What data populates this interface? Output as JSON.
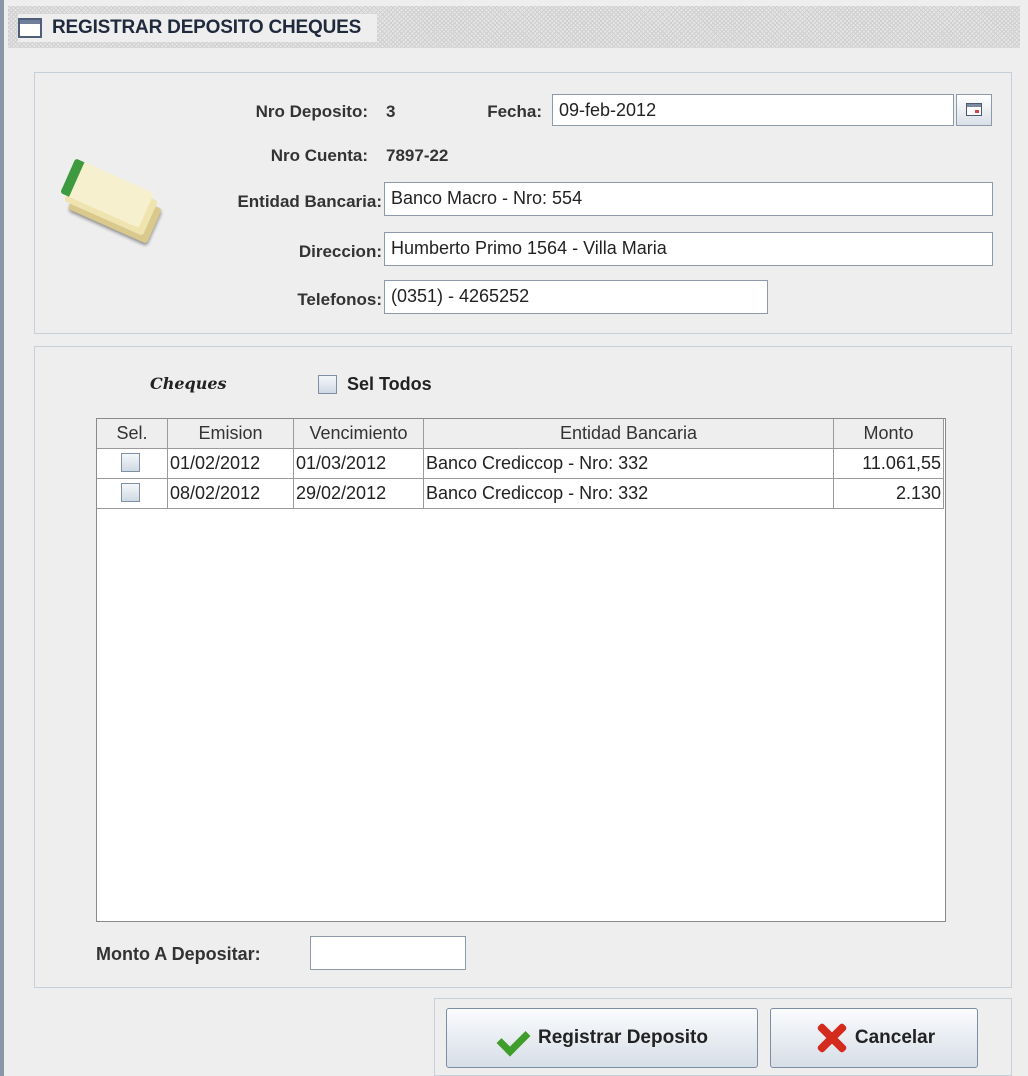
{
  "window": {
    "title": "REGISTRAR DEPOSITO CHEQUES",
    "icon": "window-icon"
  },
  "deposit": {
    "nro_deposito_label": "Nro Deposito:",
    "nro_deposito_value": "3",
    "fecha_label": "Fecha:",
    "fecha_value": "09-feb-2012",
    "nro_cuenta_label": "Nro Cuenta:",
    "nro_cuenta_value": "7897-22",
    "entidad_label": "Entidad Bancaria:",
    "entidad_value": "Banco Macro - Nro: 554",
    "direccion_label": "Direccion:",
    "direccion_value": "Humberto Primo 1564 - Villa Maria",
    "telefonos_label": "Telefonos:",
    "telefonos_value": "(0351) - 4265252",
    "calendar_icon": "calendar-icon",
    "cheques_icon": "cheques-icon"
  },
  "cheques": {
    "title": "Cheques",
    "select_all_label": "Sel Todos",
    "select_all_checked": false,
    "columns": [
      "Sel.",
      "Emision",
      "Vencimiento",
      "Entidad Bancaria",
      "Monto"
    ],
    "rows": [
      {
        "selected": false,
        "emision": "01/02/2012",
        "vencimiento": "01/03/2012",
        "entidad": "Banco Crediccop - Nro: 332",
        "monto": "11.061,55"
      },
      {
        "selected": false,
        "emision": "08/02/2012",
        "vencimiento": "29/02/2012",
        "entidad": "Banco Crediccop - Nro: 332",
        "monto": "2.130"
      }
    ]
  },
  "monto_depositar": {
    "label": "Monto A Depositar:",
    "value": ""
  },
  "actions": {
    "register_label": "Registrar Deposito",
    "register_icon": "checkmark-icon",
    "cancel_label": "Cancelar",
    "cancel_icon": "cross-icon"
  }
}
